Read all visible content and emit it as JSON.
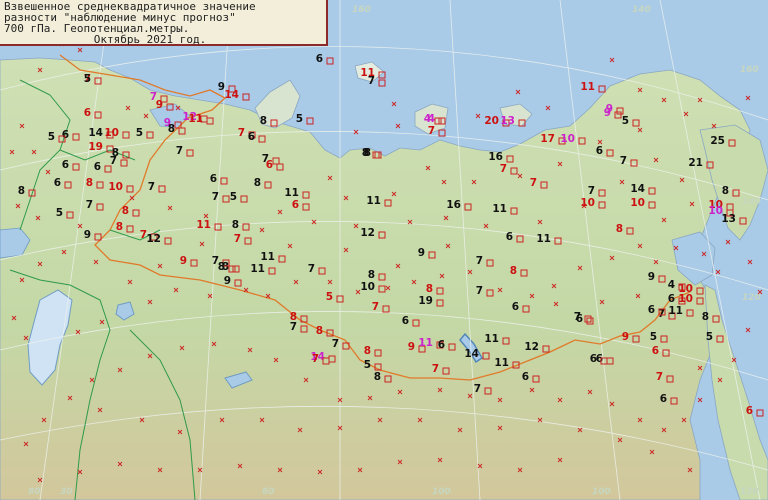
{
  "legend": {
    "line1": "Взвешенное среднеквадратичное значение",
    "line2": "разности \"наблюдение минус прогноз\"",
    "line3": "700 гПа. Геопотенциал.метры.",
    "line4": "Октябрь 2021 год."
  },
  "colors": {
    "ocean": "#a9cbe8",
    "land": "#c9ddb0",
    "land_dark": "#d6c9a0",
    "border": "#e07a2a",
    "region_border": "#2f9a4a",
    "grid": "#e8efe8",
    "marker": "#cc2222",
    "value_low": "#111111",
    "value_mid": "#cc1111",
    "value_high": "#cc22cc"
  },
  "grid_labels": [
    "160",
    "140",
    "160",
    "140",
    "120",
    "30",
    "60",
    "100",
    "80",
    "100",
    "120"
  ],
  "stations": [
    {
      "v": "7",
      "lvl": 1
    },
    {
      "v": "9",
      "lvl": 0
    },
    {
      "v": "14",
      "lvl": 1
    },
    {
      "v": "7",
      "lvl": 2
    },
    {
      "v": "9",
      "lvl": 1
    },
    {
      "v": "12",
      "lvl": 2
    },
    {
      "v": "11",
      "lvl": 1
    },
    {
      "v": "9",
      "lvl": 2
    },
    {
      "v": "6",
      "lvl": 1
    },
    {
      "v": "14",
      "lvl": 0
    },
    {
      "v": "10",
      "lvl": 1
    },
    {
      "v": "5",
      "lvl": 0
    },
    {
      "v": "8",
      "lvl": 0
    },
    {
      "v": "7",
      "lvl": 0
    },
    {
      "v": "19",
      "lvl": 1
    },
    {
      "v": "8",
      "lvl": 0
    },
    {
      "v": "6",
      "lvl": 0
    },
    {
      "v": "5",
      "lvl": 0
    },
    {
      "v": "6",
      "lvl": 0
    },
    {
      "v": "7",
      "lvl": 0
    },
    {
      "v": "8",
      "lvl": 1
    },
    {
      "v": "6",
      "lvl": 0
    },
    {
      "v": "10",
      "lvl": 1
    },
    {
      "v": "7",
      "lvl": 0
    },
    {
      "v": "6",
      "lvl": 0
    },
    {
      "v": "7",
      "lvl": 0
    },
    {
      "v": "8",
      "lvl": 1
    },
    {
      "v": "7",
      "lvl": 1
    },
    {
      "v": "8",
      "lvl": 0
    },
    {
      "v": "6",
      "lvl": 0
    },
    {
      "v": "7",
      "lvl": 0
    },
    {
      "v": "6",
      "lvl": 1
    },
    {
      "v": "5",
      "lvl": 0
    },
    {
      "v": "8",
      "lvl": 0
    },
    {
      "v": "11",
      "lvl": 0
    },
    {
      "v": "6",
      "lvl": 0
    },
    {
      "v": "7",
      "lvl": 0
    },
    {
      "v": "8",
      "lvl": 0
    },
    {
      "v": "5",
      "lvl": 0
    },
    {
      "v": "7",
      "lvl": 1
    },
    {
      "v": "11",
      "lvl": 0
    },
    {
      "v": "8",
      "lvl": 0
    },
    {
      "v": "5",
      "lvl": 0
    },
    {
      "v": "9",
      "lvl": 0
    },
    {
      "v": "8",
      "lvl": 1
    },
    {
      "v": "7",
      "lvl": 1
    },
    {
      "v": "9",
      "lvl": 1
    },
    {
      "v": "8",
      "lvl": 0
    },
    {
      "v": "12",
      "lvl": 0
    },
    {
      "v": "11",
      "lvl": 1
    },
    {
      "v": "8",
      "lvl": 0
    },
    {
      "v": "11",
      "lvl": 0
    },
    {
      "v": "7",
      "lvl": 0
    },
    {
      "v": "6",
      "lvl": 1
    },
    {
      "v": "7",
      "lvl": 0
    },
    {
      "v": "8",
      "lvl": 0
    },
    {
      "v": "11",
      "lvl": 0
    },
    {
      "v": "9",
      "lvl": 0
    },
    {
      "v": "12",
      "lvl": 0
    },
    {
      "v": "16",
      "lvl": 0
    },
    {
      "v": "9",
      "lvl": 0
    },
    {
      "v": "7",
      "lvl": 0
    },
    {
      "v": "11",
      "lvl": 0
    },
    {
      "v": "11",
      "lvl": 0
    },
    {
      "v": "6",
      "lvl": 0
    },
    {
      "v": "8",
      "lvl": 1
    },
    {
      "v": "8",
      "lvl": 0
    },
    {
      "v": "10",
      "lvl": 0
    },
    {
      "v": "5",
      "lvl": 1
    },
    {
      "v": "8",
      "lvl": 1
    },
    {
      "v": "7",
      "lvl": 0
    },
    {
      "v": "7",
      "lvl": 1
    },
    {
      "v": "6",
      "lvl": 0
    },
    {
      "v": "8",
      "lvl": 1
    },
    {
      "v": "19",
      "lvl": 0
    },
    {
      "v": "7",
      "lvl": 0
    },
    {
      "v": "6",
      "lvl": 0
    },
    {
      "v": "6",
      "lvl": 0
    },
    {
      "v": "8",
      "lvl": 1
    },
    {
      "v": "14",
      "lvl": 2
    },
    {
      "v": "7",
      "lvl": 0
    },
    {
      "v": "8",
      "lvl": 1
    },
    {
      "v": "5",
      "lvl": 0
    },
    {
      "v": "9",
      "lvl": 1
    },
    {
      "v": "11",
      "lvl": 2
    },
    {
      "v": "6",
      "lvl": 0
    },
    {
      "v": "14",
      "lvl": 0
    },
    {
      "v": "7",
      "lvl": 1
    },
    {
      "v": "11",
      "lvl": 0
    },
    {
      "v": "12",
      "lvl": 0
    },
    {
      "v": "8",
      "lvl": 0
    },
    {
      "v": "7",
      "lvl": 0
    },
    {
      "v": "11",
      "lvl": 0
    },
    {
      "v": "6",
      "lvl": 0
    },
    {
      "v": "9",
      "lvl": 1
    },
    {
      "v": "6",
      "lvl": 0
    },
    {
      "v": "5",
      "lvl": 0
    },
    {
      "v": "6",
      "lvl": 1
    },
    {
      "v": "7",
      "lvl": 1
    },
    {
      "v": "6",
      "lvl": 0
    },
    {
      "v": "7",
      "lvl": 0
    },
    {
      "v": "6",
      "lvl": 0
    },
    {
      "v": "11",
      "lvl": 0
    },
    {
      "v": "10",
      "lvl": 1
    },
    {
      "v": "10",
      "lvl": 1
    },
    {
      "v": "8",
      "lvl": 0
    },
    {
      "v": "4",
      "lvl": 0
    },
    {
      "v": "9",
      "lvl": 0
    },
    {
      "v": "6",
      "lvl": 0
    },
    {
      "v": "9",
      "lvl": 2
    },
    {
      "v": "4",
      "lvl": 2
    },
    {
      "v": "7",
      "lvl": 1
    },
    {
      "v": "20",
      "lvl": 1
    },
    {
      "v": "13",
      "lvl": 2
    },
    {
      "v": "17",
      "lvl": 1
    },
    {
      "v": "10",
      "lvl": 2
    },
    {
      "v": "11",
      "lvl": 1
    },
    {
      "v": "9",
      "lvl": 2
    },
    {
      "v": "5",
      "lvl": 0
    },
    {
      "v": "6",
      "lvl": 0
    },
    {
      "v": "7",
      "lvl": 0
    },
    {
      "v": "14",
      "lvl": 0
    },
    {
      "v": "10",
      "lvl": 1
    },
    {
      "v": "7",
      "lvl": 0
    },
    {
      "v": "10",
      "lvl": 1
    },
    {
      "v": "8",
      "lvl": 1
    },
    {
      "v": "25",
      "lvl": 0
    },
    {
      "v": "21",
      "lvl": 0
    },
    {
      "v": "8",
      "lvl": 0
    },
    {
      "v": "10",
      "lvl": 1
    },
    {
      "v": "10",
      "lvl": 2
    },
    {
      "v": "13",
      "lvl": 0
    },
    {
      "v": "11",
      "lvl": 1
    },
    {
      "v": "7",
      "lvl": 0
    },
    {
      "v": "8",
      "lvl": 0
    },
    {
      "v": "16",
      "lvl": 0
    },
    {
      "v": "7",
      "lvl": 1
    },
    {
      "v": "4",
      "lvl": 2
    },
    {
      "v": "7",
      "lvl": 1
    },
    {
      "v": "7",
      "lvl": 0
    },
    {
      "v": "6",
      "lvl": 0
    },
    {
      "v": "5",
      "lvl": 0
    },
    {
      "v": "6",
      "lvl": 1
    },
    {
      "v": "7",
      "lvl": 1
    },
    {
      "v": "6",
      "lvl": 0
    },
    {
      "v": "5",
      "lvl": 0
    }
  ]
}
